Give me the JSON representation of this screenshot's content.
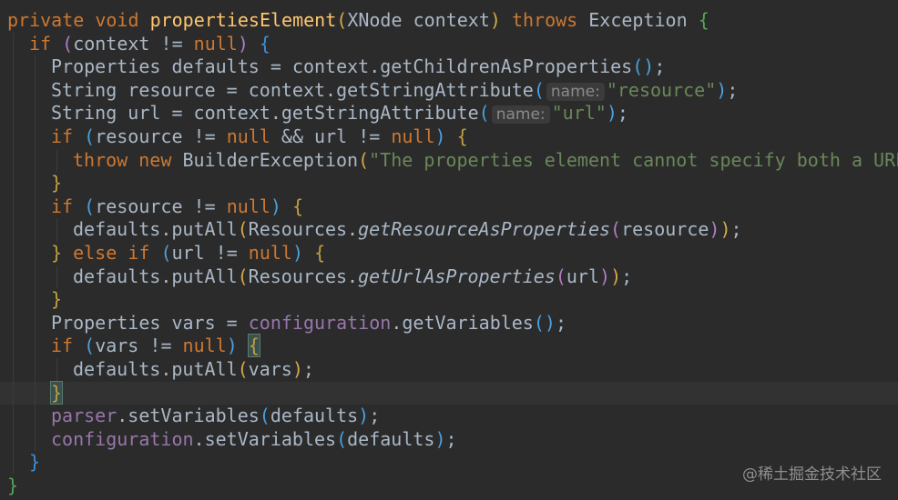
{
  "lines": [
    "private void propertiesElement(XNode context) throws Exception {",
    "if (context != null) {",
    "Properties defaults = context.getChildrenAsProperties();",
    "String resource = context.getStringAttribute( name: \"resource\");",
    "String url = context.getStringAttribute( name: \"url\");",
    "if (resource != null && url != null) {",
    "throw new BuilderException(\"The properties element cannot specify both a URL",
    "}",
    "if (resource != null) {",
    "defaults.putAll(Resources.getResourceAsProperties(resource));",
    "} else if (url != null) {",
    "defaults.putAll(Resources.getUrlAsProperties(url));",
    "}",
    "Properties vars = configuration.getVariables();",
    "if (vars != null) {",
    "defaults.putAll(vars);",
    "}",
    "parser.setVariables(defaults);",
    "configuration.setVariables(defaults);",
    "}",
    "}"
  ],
  "tokens": {
    "private": "private",
    "void": "void",
    "method_name": "propertiesElement",
    "xnode": "XNode",
    "context": "context",
    "throws": "throws",
    "exception": "Exception",
    "if": "if",
    "null": "null",
    "properties": "Properties",
    "defaults": "defaults",
    "get_children": "getChildrenAsProperties",
    "string": "String",
    "resource": "resource",
    "url": "url",
    "get_string_attr": "getStringAttribute",
    "hint_name": "name:",
    "str_resource": "\"resource\"",
    "str_url": "\"url\"",
    "throw": "throw",
    "new": "new",
    "builder_exception": "BuilderException",
    "error_message": "\"The properties element cannot specify both a URL",
    "put_all": "putAll",
    "resources": "Resources",
    "get_resource_as_props": "getResourceAsProperties",
    "else": "else",
    "get_url_as_props": "getUrlAsProperties",
    "vars": "vars",
    "configuration": "configuration",
    "get_variables": "getVariables",
    "parser": "parser",
    "set_variables": "setVariables"
  },
  "watermark": "@稀土掘金技术社区",
  "colors": {
    "background": "#2b2b2b",
    "current_line": "#323232",
    "default_text": "#a9b7c6",
    "keyword": "#cc7832",
    "method_decl": "#ffc66d",
    "string": "#6a8759",
    "field": "#9876aa"
  }
}
